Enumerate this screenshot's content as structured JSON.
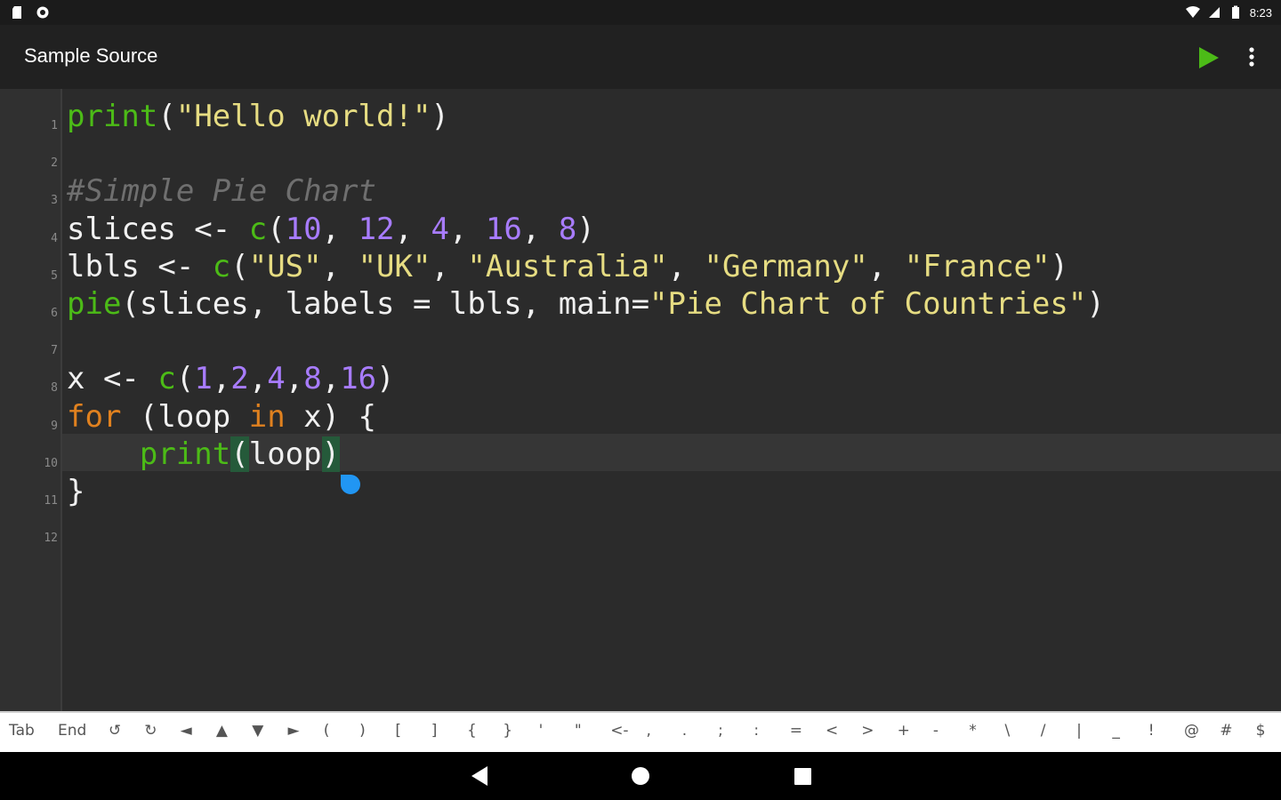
{
  "status_bar": {
    "time": "8:23",
    "left_icons": [
      "sd-card-icon",
      "sync-icon"
    ],
    "right_icons": [
      "wifi-icon",
      "cellular-icon",
      "battery-icon"
    ]
  },
  "app_bar": {
    "title": "Sample Source",
    "run_icon": "play-icon",
    "menu_icon": "more-vert-icon",
    "accent_color": "#4cbb17"
  },
  "editor": {
    "line_numbers": [
      "1",
      "2",
      "3",
      "4",
      "5",
      "6",
      "7",
      "8",
      "9",
      "10",
      "11",
      "12"
    ],
    "active_line": 10,
    "colors": {
      "function": "#4cbb17",
      "keyword": "#e0811f",
      "string": "#e6dc82",
      "number": "#a87cff",
      "comment": "#6f6f6f",
      "text": "#f0f0f0"
    },
    "lines": [
      [
        {
          "t": "print",
          "c": "kw-fn"
        },
        {
          "t": "(",
          "c": ""
        },
        {
          "t": "\"Hello world!\"",
          "c": "str"
        },
        {
          "t": ")",
          "c": ""
        }
      ],
      [],
      [
        {
          "t": "#Simple Pie Chart",
          "c": "cmt"
        }
      ],
      [
        {
          "t": "slices <- ",
          "c": ""
        },
        {
          "t": "c",
          "c": "kw-fn"
        },
        {
          "t": "(",
          "c": ""
        },
        {
          "t": "10",
          "c": "num"
        },
        {
          "t": ", ",
          "c": ""
        },
        {
          "t": "12",
          "c": "num"
        },
        {
          "t": ", ",
          "c": ""
        },
        {
          "t": "4",
          "c": "num"
        },
        {
          "t": ", ",
          "c": ""
        },
        {
          "t": "16",
          "c": "num"
        },
        {
          "t": ", ",
          "c": ""
        },
        {
          "t": "8",
          "c": "num"
        },
        {
          "t": ")",
          "c": ""
        }
      ],
      [
        {
          "t": "lbls <- ",
          "c": ""
        },
        {
          "t": "c",
          "c": "kw-fn"
        },
        {
          "t": "(",
          "c": ""
        },
        {
          "t": "\"US\"",
          "c": "str"
        },
        {
          "t": ", ",
          "c": ""
        },
        {
          "t": "\"UK\"",
          "c": "str"
        },
        {
          "t": ", ",
          "c": ""
        },
        {
          "t": "\"Australia\"",
          "c": "str"
        },
        {
          "t": ", ",
          "c": ""
        },
        {
          "t": "\"Germany\"",
          "c": "str"
        },
        {
          "t": ", ",
          "c": ""
        },
        {
          "t": "\"France\"",
          "c": "str"
        },
        {
          "t": ")",
          "c": ""
        }
      ],
      [
        {
          "t": "pie",
          "c": "kw-fn"
        },
        {
          "t": "(slices, labels = lbls, main=",
          "c": ""
        },
        {
          "t": "\"Pie Chart of Countries\"",
          "c": "str"
        },
        {
          "t": ")",
          "c": ""
        }
      ],
      [],
      [
        {
          "t": "x <- ",
          "c": ""
        },
        {
          "t": "c",
          "c": "kw-fn"
        },
        {
          "t": "(",
          "c": ""
        },
        {
          "t": "1",
          "c": "num"
        },
        {
          "t": ",",
          "c": ""
        },
        {
          "t": "2",
          "c": "num"
        },
        {
          "t": ",",
          "c": ""
        },
        {
          "t": "4",
          "c": "num"
        },
        {
          "t": ",",
          "c": ""
        },
        {
          "t": "8",
          "c": "num"
        },
        {
          "t": ",",
          "c": ""
        },
        {
          "t": "16",
          "c": "num"
        },
        {
          "t": ")",
          "c": ""
        }
      ],
      [
        {
          "t": "for",
          "c": "kw"
        },
        {
          "t": " (loop ",
          "c": ""
        },
        {
          "t": "in",
          "c": "kw"
        },
        {
          "t": " x) {",
          "c": ""
        }
      ],
      [
        {
          "t": "    ",
          "c": ""
        },
        {
          "t": "print",
          "c": "kw-fn"
        },
        {
          "t": "(",
          "c": "bracket-hl"
        },
        {
          "t": "loop",
          "c": ""
        },
        {
          "t": ")",
          "c": "bracket-hl"
        }
      ],
      [
        {
          "t": "}",
          "c": ""
        }
      ],
      []
    ]
  },
  "symbol_bar": {
    "keys": [
      "Tab",
      "End",
      "↺",
      "↻",
      "◄",
      "▲",
      "▼",
      "►",
      "(",
      ")",
      "[",
      "]",
      "{",
      "}",
      "'",
      "\"",
      "<-",
      ",",
      ".",
      ";",
      ":",
      "=",
      "<",
      ">",
      "+",
      "-",
      "*",
      "\\",
      "/",
      "|",
      "_",
      "!",
      "@",
      "#",
      "$"
    ]
  },
  "nav_bar": {
    "icons": [
      "back-icon",
      "home-icon",
      "recents-icon"
    ]
  }
}
